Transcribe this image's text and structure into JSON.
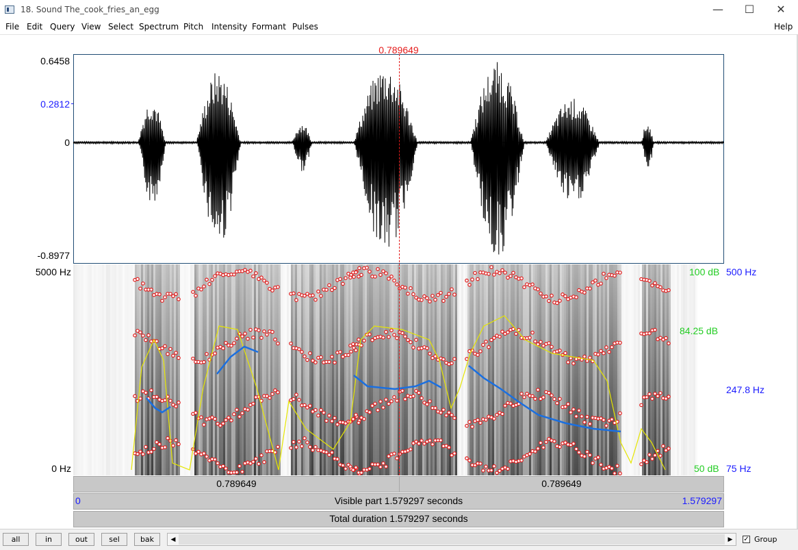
{
  "window": {
    "title": "18. Sound The_cook_fries_an_egg",
    "minimize": "—",
    "maximize": "☐",
    "close": "✕"
  },
  "menu": [
    "File",
    "Edit",
    "Query",
    "View",
    "Select",
    "Spectrum",
    "Pitch",
    "Intensity",
    "Formant",
    "Pulses"
  ],
  "help": "Help",
  "cursor": {
    "time_label": "0.789649"
  },
  "waveform": {
    "max": "0.6458",
    "cursor_value": "0.2812",
    "zero": "0",
    "min": "-0.8977"
  },
  "spectrogram": {
    "freq_top": "5000 Hz",
    "freq_bottom": "0 Hz",
    "db_top": "100 dB",
    "db_mid": "84.25 dB",
    "db_bottom": "50 dB",
    "pitch_top": "500 Hz",
    "pitch_mid": "247.8 Hz",
    "pitch_bottom": "75 Hz"
  },
  "time_bars": {
    "left_segment": "0.789649",
    "right_segment": "0.789649",
    "visible_start": "0",
    "visible_part": "Visible part 1.579297 seconds",
    "visible_end": "1.579297",
    "total": "Total duration 1.579297 seconds"
  },
  "buttons": {
    "all": "all",
    "in": "in",
    "out": "out",
    "sel": "sel",
    "bak": "bak"
  },
  "scroll": {
    "left_arrow": "◀",
    "right_arrow": "▶"
  },
  "group": {
    "label": "Group",
    "checked": "✓"
  },
  "colors": {
    "pitch": "#1a6fe0",
    "intensity": "#e6e600",
    "formant": "#e01a1a",
    "cursor": "#e41a1a",
    "frame": "#1e4b73"
  }
}
